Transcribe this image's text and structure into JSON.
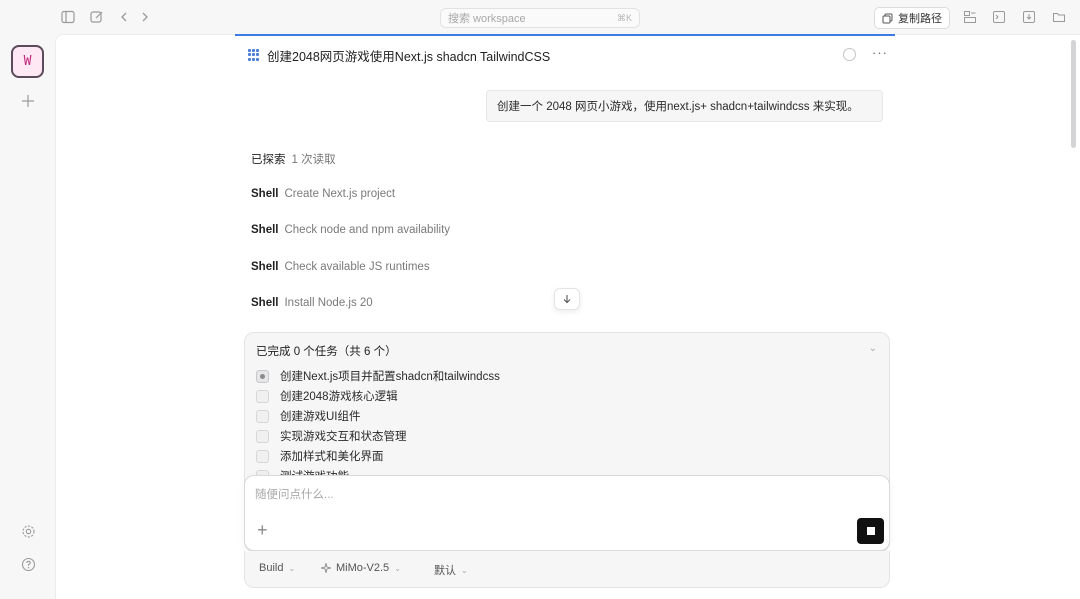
{
  "topbar": {
    "search_placeholder": "搜索 workspace",
    "search_shortcut": "⌘K",
    "copy_path_label": "复制路径"
  },
  "workspace": {
    "avatar_letter": "W"
  },
  "chat": {
    "title": "创建2048网页游戏使用Next.js shadcn TailwindCSS",
    "user_message": "创建一个 2048 网页小游戏，使用next.js+ shadcn+tailwindcss 来实现。",
    "explored_label": "已探索",
    "explored_detail": "1 次读取",
    "shell_steps": [
      {
        "kind": "Shell",
        "text": "Create Next.js project"
      },
      {
        "kind": "Shell",
        "text": "Check node and npm availability"
      },
      {
        "kind": "Shell",
        "text": "Check available JS runtimes"
      },
      {
        "kind": "Shell",
        "text": "Install Node.js 20"
      }
    ]
  },
  "tasks": {
    "header": "已完成 0 个任务（共 6 个）",
    "items": [
      {
        "label": "创建Next.js项目并配置shadcn和tailwindcss",
        "state": "in-progress"
      },
      {
        "label": "创建2048游戏核心逻辑",
        "state": "pending"
      },
      {
        "label": "创建游戏UI组件",
        "state": "pending"
      },
      {
        "label": "实现游戏交互和状态管理",
        "state": "pending"
      },
      {
        "label": "添加样式和美化界面",
        "state": "pending"
      },
      {
        "label": "测试游戏功能",
        "state": "pending"
      }
    ]
  },
  "composer": {
    "placeholder": "随便问点什么...",
    "agent_mode": "Build",
    "model": "MiMo-V2.5",
    "variant": "默认"
  },
  "colors": {
    "accent": "#3b7be6",
    "avatar_bg": "#fde8f3",
    "avatar_fg": "#c2287a"
  }
}
